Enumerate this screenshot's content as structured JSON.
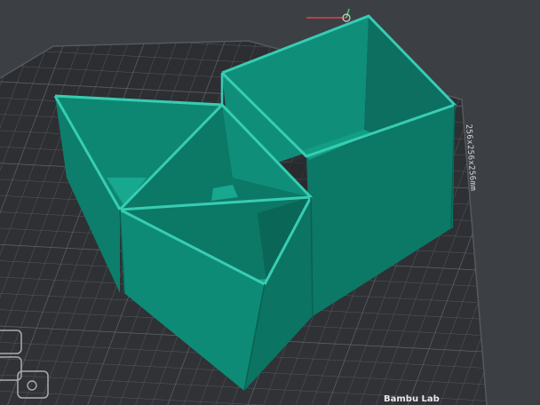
{
  "viewport": {
    "name": "3D slicer viewport",
    "bed": {
      "dimension_label": "256x256x256mm"
    },
    "model": {
      "color": "#0f8f7a",
      "rim_color": "#35c9af",
      "shadow_color": "#0a6b5c"
    },
    "plate_text": "Bambu Lab"
  }
}
